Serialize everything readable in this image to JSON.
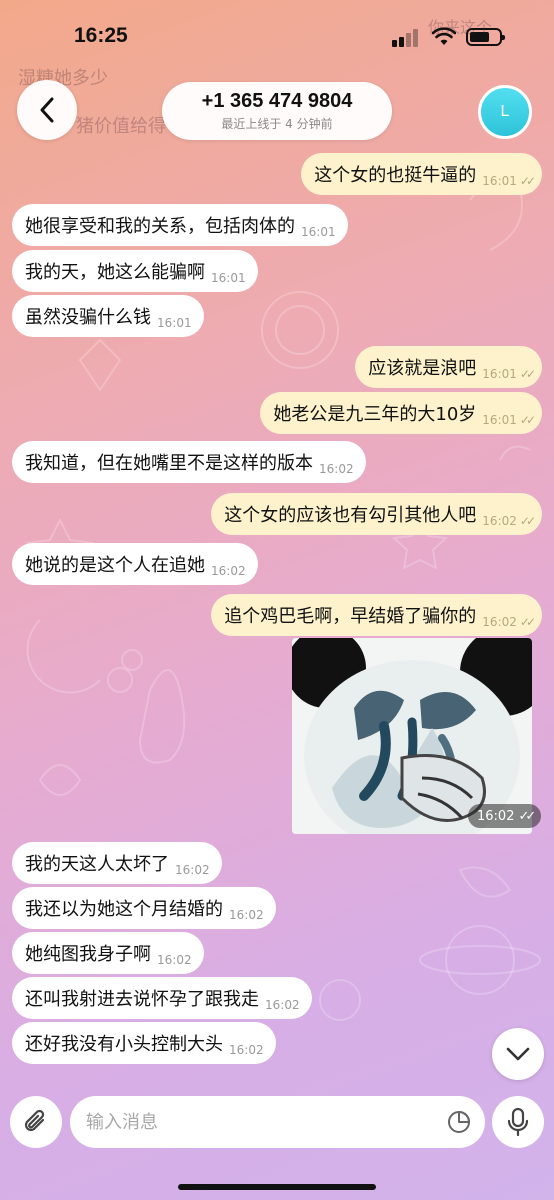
{
  "status": {
    "time": "16:25"
  },
  "background_ghost": {
    "line1": "湿糖她多少",
    "line2": "猪价值给得",
    "top_right": "你来这个"
  },
  "header": {
    "back_icon": "chevron-left-icon",
    "contact_name": "+1 365 474 9804",
    "last_seen": "最近上线于 4 分钟前",
    "avatar_letter": "L",
    "avatar_color": "#3fd2e6"
  },
  "messages": [
    {
      "dir": "out",
      "text": "这个女的也挺牛逼的",
      "time": "16:01",
      "read": true
    },
    {
      "dir": "in",
      "text": "她很享受和我的关系，包括肉体的",
      "time": "16:01"
    },
    {
      "dir": "in",
      "text": "我的天，她这么能骗啊",
      "time": "16:01"
    },
    {
      "dir": "in",
      "text": "虽然没骗什么钱",
      "time": "16:01"
    },
    {
      "dir": "out",
      "text": "应该就是浪吧",
      "time": "16:01",
      "read": true
    },
    {
      "dir": "out",
      "text": "她老公是九三年的大10岁",
      "time": "16:01",
      "read": true
    },
    {
      "dir": "in",
      "text": "我知道，但在她嘴里不是这样的版本",
      "time": "16:02"
    },
    {
      "dir": "out",
      "text": "这个女的应该也有勾引其他人吧",
      "time": "16:02",
      "read": true
    },
    {
      "dir": "in",
      "text": "她说的是这个人在追她",
      "time": "16:02"
    },
    {
      "dir": "out",
      "text": "追个鸡巴毛啊，早结婚了骗你的",
      "time": "16:02",
      "read": true
    },
    {
      "dir": "in",
      "text": "我的天这人太坏了",
      "time": "16:02"
    },
    {
      "dir": "in",
      "text": "我还以为她这个月结婚的",
      "time": "16:02"
    },
    {
      "dir": "in",
      "text": "她纯图我身子啊",
      "time": "16:02"
    },
    {
      "dir": "in",
      "text": "还叫我射进去说怀孕了跟我走",
      "time": "16:02"
    },
    {
      "dir": "in",
      "text": "还好我没有小头控制大头",
      "time": "16:02"
    }
  ],
  "sticker": {
    "time": "16:02",
    "description_icon": "panda-meme-sticker"
  },
  "checkmark": "✓✓",
  "composer": {
    "placeholder": "输入消息",
    "attach_icon": "paperclip-icon",
    "sticker_icon": "sticker-icon",
    "mic_icon": "microphone-icon",
    "scroll_icon": "chevron-down-icon"
  },
  "colors": {
    "outgoing_bubble": "#fdf2cc",
    "incoming_bubble": "#ffffff"
  }
}
